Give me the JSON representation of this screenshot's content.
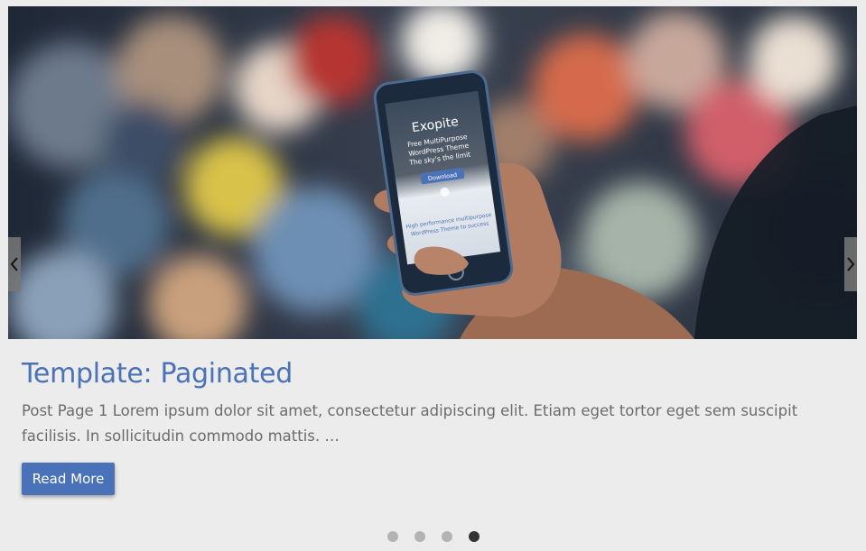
{
  "slide": {
    "image": {
      "phone_screen": {
        "brand": "Exopite",
        "tagline_1": "Free MultiPurpose",
        "tagline_2": "WordPress Theme",
        "tagline_3": "The sky's the limit",
        "button": "Download",
        "body_1": "High performance multipurpose",
        "body_2": "WordPress Theme to success"
      }
    },
    "title": "Template: Paginated",
    "excerpt": "Post Page 1 Lorem ipsum dolor sit amet, consectetur adipiscing elit. Etiam eget tortor eget sem suscipit facilisis. In sollicitudin commodo mattis. …",
    "read_more_label": "Read More"
  },
  "navigation": {
    "prev_icon": "chevron-left-icon",
    "next_icon": "chevron-right-icon"
  },
  "pagination": {
    "total": 4,
    "active_index": 3
  },
  "colors": {
    "title": "#4a72b4",
    "button": "#4a72b8",
    "background": "#ececec",
    "dot_inactive": "#b3b3b3",
    "dot_active": "#333333"
  }
}
